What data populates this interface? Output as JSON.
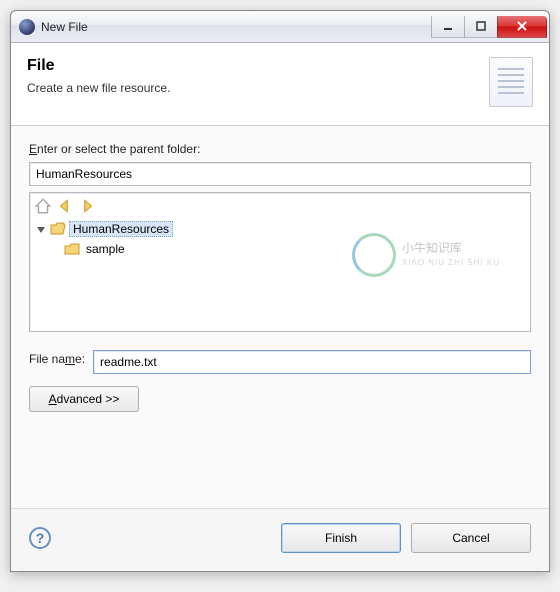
{
  "window": {
    "title": "New File"
  },
  "banner": {
    "heading": "File",
    "subheading": "Create a new file resource."
  },
  "parentFolder": {
    "label_pre": "E",
    "label_rest": "nter or select the parent folder:",
    "value": "HumanResources"
  },
  "tree": {
    "root": {
      "name": "HumanResources",
      "expanded": true,
      "selected": true
    },
    "children": [
      {
        "name": "sample"
      }
    ]
  },
  "fileName": {
    "label_pre": "File na",
    "label_u": "m",
    "label_post": "e:",
    "value": "readme.txt"
  },
  "buttons": {
    "advanced_u": "A",
    "advanced_rest": "dvanced >>",
    "finish": "Finish",
    "cancel": "Cancel"
  },
  "watermark": {
    "cn": "小牛知识库",
    "en": "XIAO NIU ZHI SHI KU"
  }
}
